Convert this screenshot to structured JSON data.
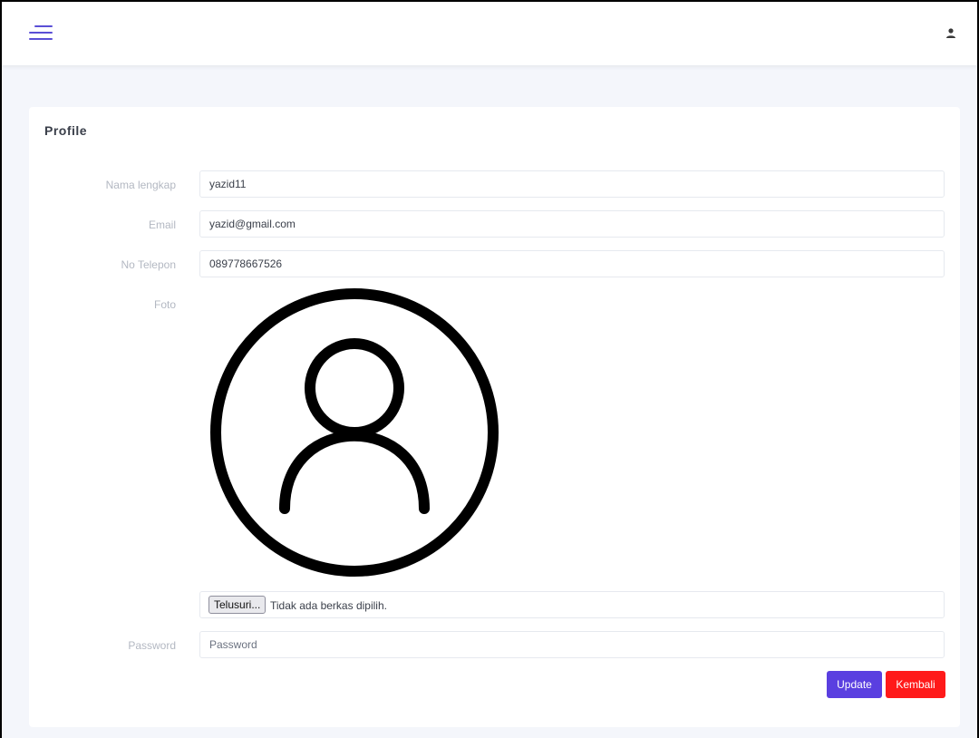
{
  "header": {
    "menu_icon": "hamburger-menu-icon",
    "user_icon": "user-icon",
    "accent_color": "#5a4fd6"
  },
  "card": {
    "title": "Profile"
  },
  "form": {
    "nama_lengkap": {
      "label": "Nama lengkap",
      "value": "yazid11"
    },
    "email": {
      "label": "Email",
      "value": "yazid@gmail.com"
    },
    "no_telepon": {
      "label": "No Telepon",
      "value": "089778667526"
    },
    "foto": {
      "label": "Foto",
      "avatar_icon": "user-avatar-icon",
      "file_button": "Telusuri...",
      "file_status": "Tidak ada berkas dipilih."
    },
    "password": {
      "label": "Password",
      "placeholder": "Password"
    }
  },
  "actions": {
    "update_label": "Update",
    "update_color": "#5a3fe0",
    "kembali_label": "Kembali",
    "kembali_color": "#ff1a1a"
  }
}
